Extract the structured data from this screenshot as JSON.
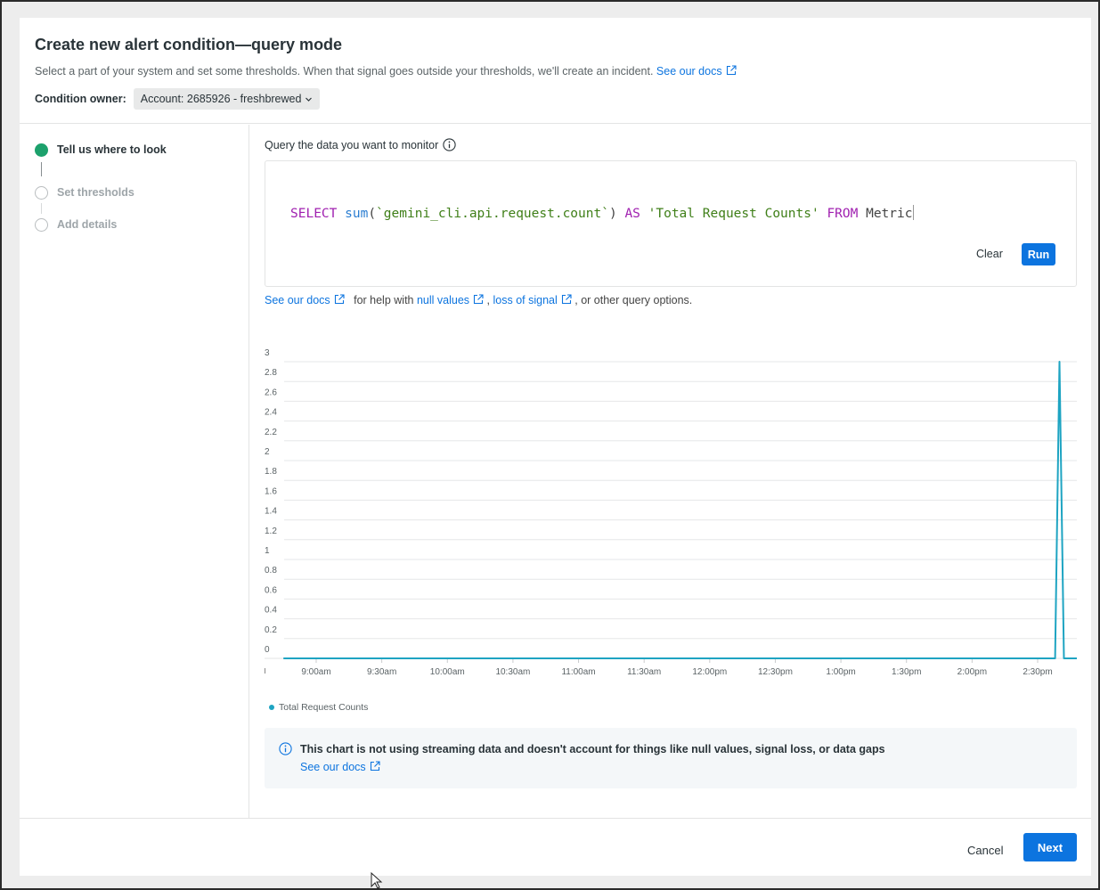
{
  "header": {
    "title": "Create new alert condition—query mode",
    "subtitle": "Select a part of your system and set some thresholds. When that signal goes outside your thresholds, we'll create an incident.",
    "docs_link": "See our docs",
    "owner_label": "Condition owner:",
    "owner_value": "Account: 2685926 - freshbrewed"
  },
  "steps": [
    {
      "label": "Tell us where to look",
      "state": "active"
    },
    {
      "label": "Set thresholds",
      "state": "inactive"
    },
    {
      "label": "Add details",
      "state": "inactive"
    }
  ],
  "query": {
    "label": "Query the data you want to monitor",
    "tokens": {
      "select": "SELECT",
      "fn": "sum",
      "open": "(",
      "attr": "`gemini_cli.api.request.count`",
      "close": ")",
      "as": "AS",
      "alias": "'Total Request Counts'",
      "from": "FROM",
      "table": "Metric"
    },
    "clear_label": "Clear",
    "run_label": "Run"
  },
  "help": {
    "docs_link": "See our docs",
    "text1": "for help with",
    "null_values": "null values",
    "comma": ",",
    "loss_of_signal": "loss of signal",
    "text2": ", or other query options."
  },
  "chart_data": {
    "type": "line",
    "x": [
      "9:00am",
      "9:30am",
      "10:00am",
      "10:30am",
      "11:00am",
      "11:30am",
      "12:00pm",
      "12:30pm",
      "1:00pm",
      "1:30pm",
      "2:00pm",
      "2:30pm"
    ],
    "xlabel": "",
    "ylabel": "",
    "ylim": [
      0,
      3
    ],
    "y_ticks": [
      "0",
      "0.2",
      "0.4",
      "0.6",
      "0.8",
      "1",
      "1.2",
      "1.4",
      "1.6",
      "1.8",
      "2",
      "2.2",
      "2.4",
      "2.6",
      "2.8",
      "3"
    ],
    "series": [
      {
        "name": "Total Request Counts",
        "color": "#1ea4c2",
        "points": [
          {
            "t": "8:45am",
            "v": 0
          },
          {
            "t": "2:38pm",
            "v": 0
          },
          {
            "t": "2:40pm",
            "v": 3
          },
          {
            "t": "2:42pm",
            "v": 0
          },
          {
            "t": "2:50pm",
            "v": 0
          }
        ]
      }
    ],
    "grid": true,
    "legend": "bottom-left"
  },
  "legend_label": "Total Request Counts",
  "notice": {
    "text": "This chart is not using streaming data and doesn't account for things like null values, signal loss, or data gaps",
    "docs_link": "See our docs"
  },
  "footer": {
    "cancel_label": "Cancel",
    "next_label": "Next"
  },
  "colors": {
    "accent": "#0c74df",
    "step_active": "#1ca16c",
    "series": "#1ea4c2"
  }
}
